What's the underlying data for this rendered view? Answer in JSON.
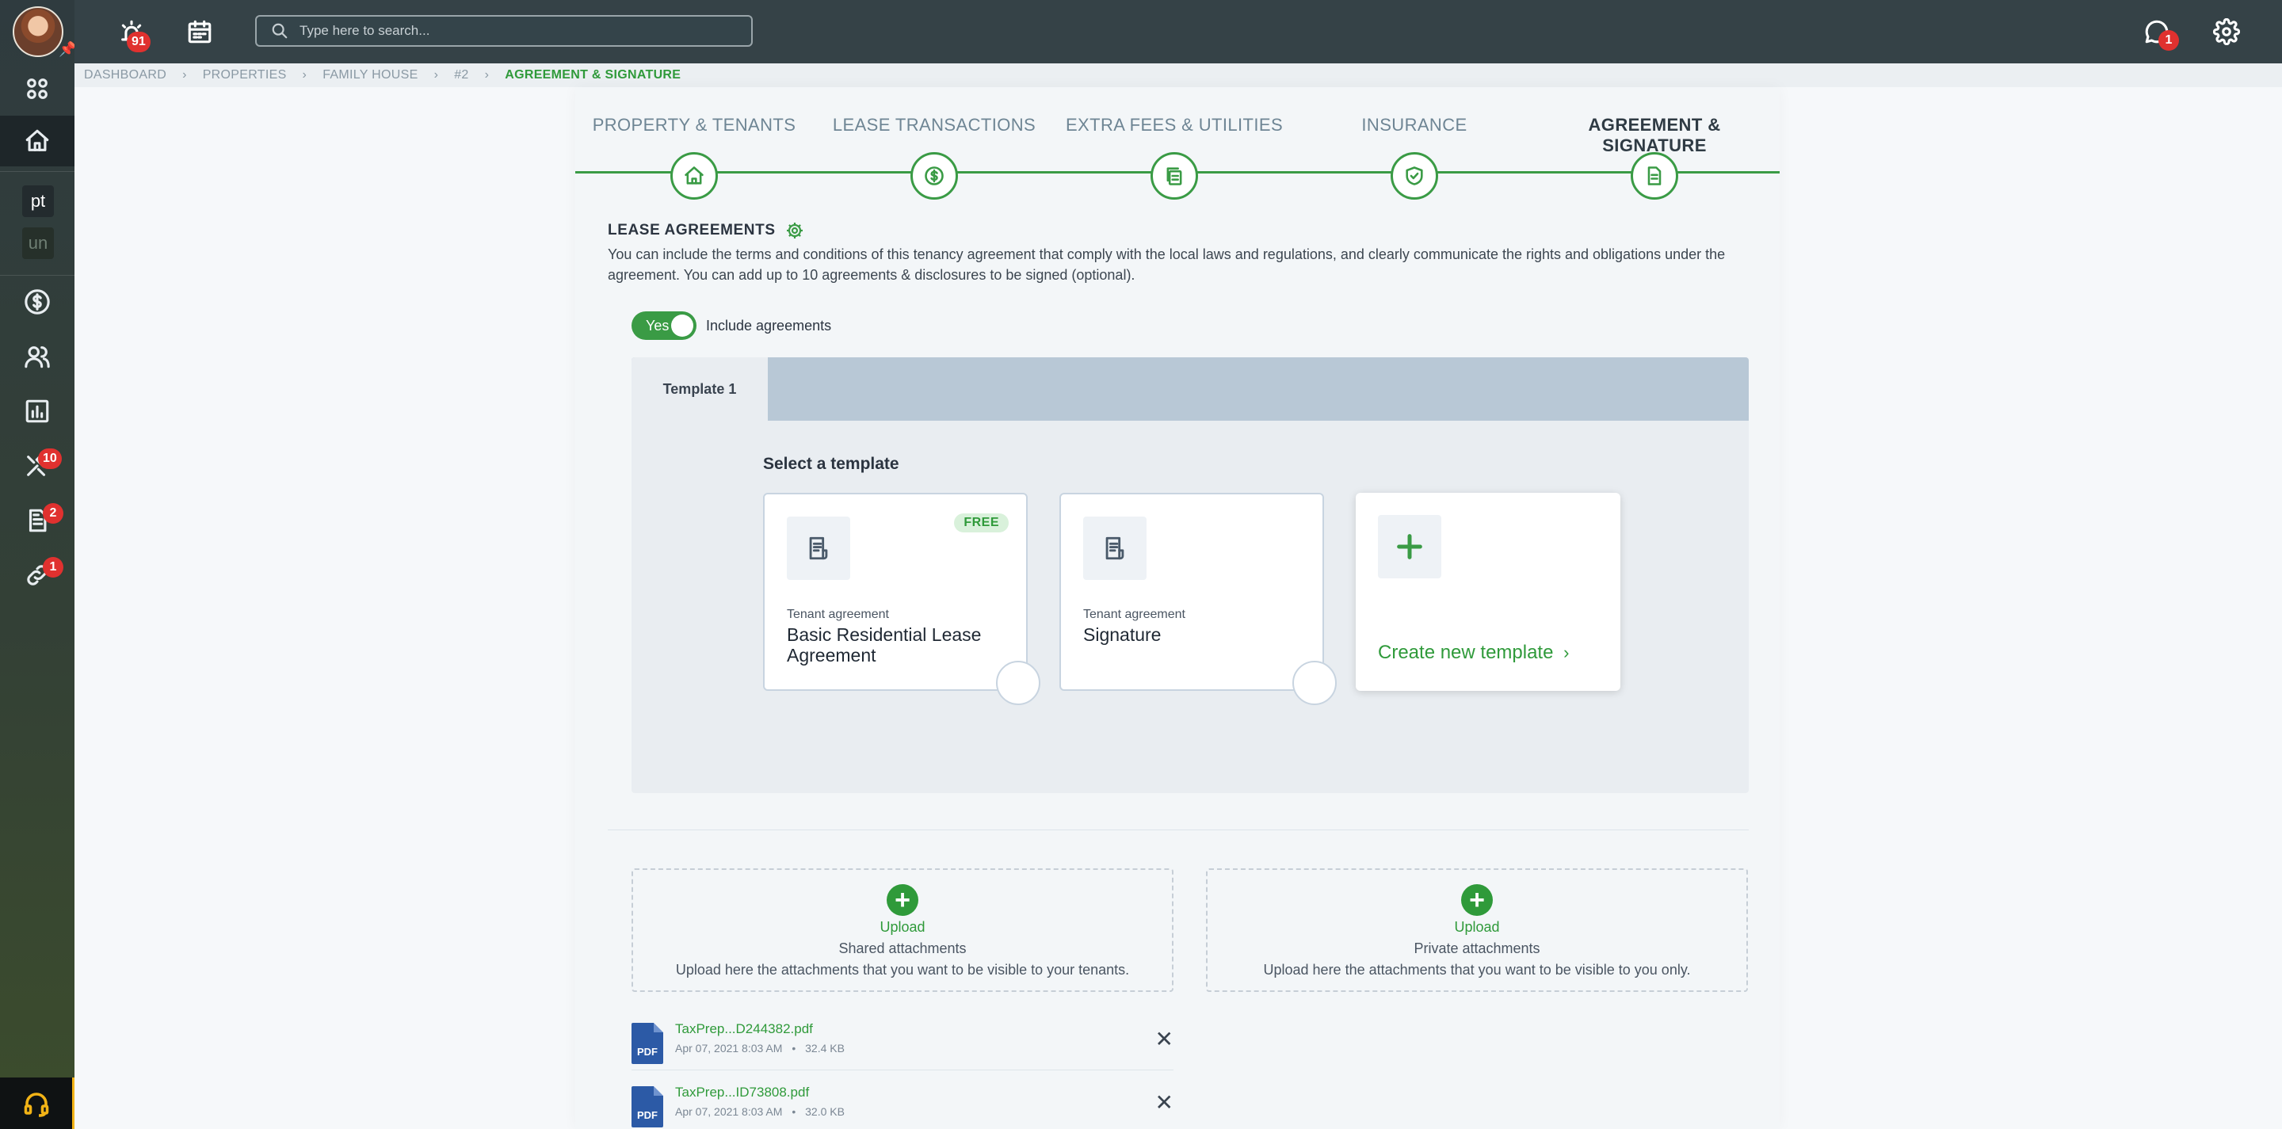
{
  "topbar": {
    "alerts_badge": "91",
    "search_placeholder": "Type here to search...",
    "chat_badge": "1"
  },
  "sidebar": {
    "workspaces": [
      "pt",
      "un"
    ],
    "badges": {
      "tools": "10",
      "documents": "2",
      "links": "1"
    }
  },
  "breadcrumb": [
    "DASHBOARD",
    "PROPERTIES",
    "FAMILY HOUSE",
    "#2",
    "AGREEMENT & SIGNATURE"
  ],
  "steps": [
    {
      "label": "PROPERTY & TENANTS",
      "icon": "home-icon"
    },
    {
      "label": "LEASE TRANSACTIONS",
      "icon": "dollar-icon"
    },
    {
      "label": "EXTRA FEES & UTILITIES",
      "icon": "copy-icon"
    },
    {
      "label": "INSURANCE",
      "icon": "shield-check-icon"
    },
    {
      "label": "AGREEMENT & SIGNATURE",
      "icon": "document-icon"
    }
  ],
  "lease": {
    "title": "LEASE AGREEMENTS",
    "description": "You can include the terms and conditions of this tenancy agreement that comply with the local laws and regulations, and clearly communicate the rights and obligations under the agreement. You can add up to 10 agreements & disclosures to be signed (optional).",
    "toggle_value": "Yes",
    "toggle_label": "Include agreements"
  },
  "templates": {
    "tab": "Template 1",
    "select_label": "Select a template",
    "cards": [
      {
        "subtitle": "Tenant agreement",
        "name": "Basic Residential Lease Agreement",
        "badge": "FREE"
      },
      {
        "subtitle": "Tenant agreement",
        "name": "Signature"
      }
    ],
    "create_label": "Create new template",
    "create_chevron": "›"
  },
  "uploads": [
    {
      "action": "Upload",
      "title": "Shared attachments",
      "description": "Upload here the attachments that you want to be visible to your tenants."
    },
    {
      "action": "Upload",
      "title": "Private attachments",
      "description": "Upload here the attachments that you want to be visible to you only."
    }
  ],
  "files": [
    {
      "type": "PDF",
      "name": "TaxPrep...D244382.pdf",
      "date": "Apr 07, 2021 8:03 AM",
      "size": "32.4 KB"
    },
    {
      "type": "PDF",
      "name": "TaxPrep...ID73808.pdf",
      "date": "Apr 07, 2021 8:03 AM",
      "size": "32.0 KB"
    }
  ],
  "colors": {
    "accent": "#3a9b45",
    "topbar": "#354247",
    "badge": "#e0312f"
  }
}
